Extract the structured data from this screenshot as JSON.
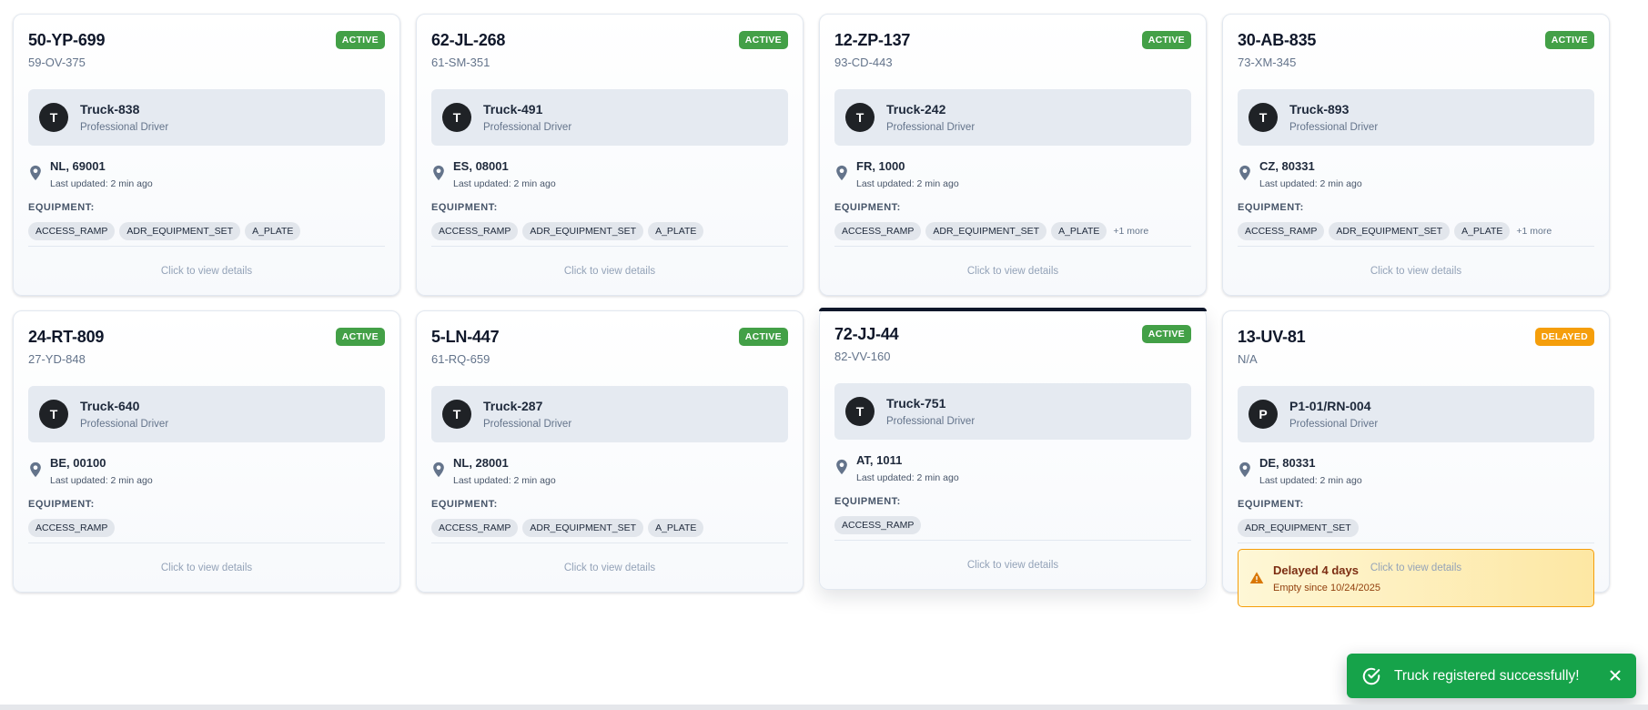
{
  "common": {
    "driver_role": "Professional Driver",
    "last_updated": "Last updated: 2 min ago",
    "equipment_label": "EQUIPMENT:",
    "footer_text": "Click to view details"
  },
  "trucks": [
    {
      "plate": "50-YP-699",
      "trailer": "59-OV-375",
      "status": "ACTIVE",
      "driver_initial": "T",
      "driver_name": "Truck-838",
      "location": "NL, 69001",
      "equipment": [
        "ACCESS_RAMP",
        "ADR_EQUIPMENT_SET",
        "A_PLATE"
      ],
      "more": ""
    },
    {
      "plate": "62-JL-268",
      "trailer": "61-SM-351",
      "status": "ACTIVE",
      "driver_initial": "T",
      "driver_name": "Truck-491",
      "location": "ES, 08001",
      "equipment": [
        "ACCESS_RAMP",
        "ADR_EQUIPMENT_SET",
        "A_PLATE"
      ],
      "more": ""
    },
    {
      "plate": "12-ZP-137",
      "trailer": "93-CD-443",
      "status": "ACTIVE",
      "driver_initial": "T",
      "driver_name": "Truck-242",
      "location": "FR, 1000",
      "equipment": [
        "ACCESS_RAMP",
        "ADR_EQUIPMENT_SET",
        "A_PLATE"
      ],
      "more": "+1 more"
    },
    {
      "plate": "30-AB-835",
      "trailer": "73-XM-345",
      "status": "ACTIVE",
      "driver_initial": "T",
      "driver_name": "Truck-893",
      "location": "CZ, 80331",
      "equipment": [
        "ACCESS_RAMP",
        "ADR_EQUIPMENT_SET",
        "A_PLATE"
      ],
      "more": "+1 more"
    },
    {
      "plate": "24-RT-809",
      "trailer": "27-YD-848",
      "status": "ACTIVE",
      "driver_initial": "T",
      "driver_name": "Truck-640",
      "location": "BE, 00100",
      "equipment": [
        "ACCESS_RAMP"
      ],
      "more": ""
    },
    {
      "plate": "5-LN-447",
      "trailer": "61-RQ-659",
      "status": "ACTIVE",
      "driver_initial": "T",
      "driver_name": "Truck-287",
      "location": "NL, 28001",
      "equipment": [
        "ACCESS_RAMP",
        "ADR_EQUIPMENT_SET",
        "A_PLATE"
      ],
      "more": ""
    },
    {
      "plate": "72-JJ-44",
      "trailer": "82-VV-160",
      "status": "ACTIVE",
      "driver_initial": "T",
      "driver_name": "Truck-751",
      "location": "AT, 1011",
      "equipment": [
        "ACCESS_RAMP"
      ],
      "more": "",
      "hovered": true
    },
    {
      "plate": "13-UV-81",
      "trailer": "N/A",
      "status": "DELAYED",
      "driver_initial": "P",
      "driver_name": "P1-01/RN-004",
      "location": "DE, 80331",
      "equipment": [
        "ADR_EQUIPMENT_SET"
      ],
      "more": "",
      "delay": {
        "title": "Delayed 4 days",
        "subtitle": "Empty since 10/24/2025"
      }
    }
  ],
  "toast": {
    "message": "Truck registered successfully!",
    "icon": "check-circle-icon",
    "close_icon": "close-icon"
  },
  "colors": {
    "active": "#43a047",
    "delayed": "#f59e0b",
    "toast": "#16a34a",
    "avatar": "#1f2226"
  }
}
